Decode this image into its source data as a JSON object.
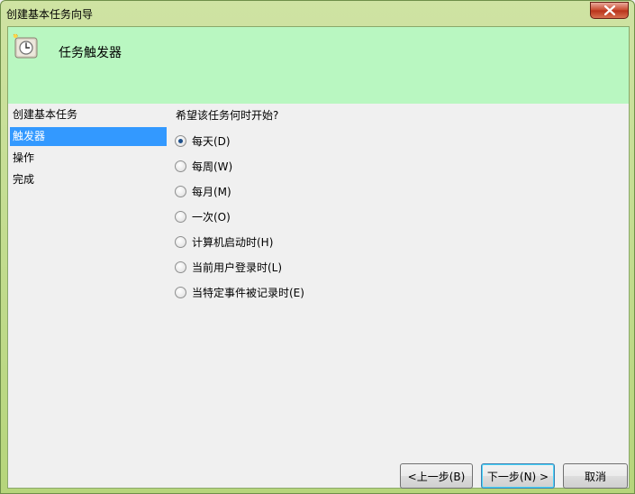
{
  "window": {
    "title": "创建基本任务向导"
  },
  "header": {
    "title": "任务触发器",
    "icon": "clock-icon"
  },
  "steps": [
    {
      "label": "创建基本任务",
      "active": false
    },
    {
      "label": "触发器",
      "active": true
    },
    {
      "label": "操作",
      "active": false
    },
    {
      "label": "完成",
      "active": false
    }
  ],
  "content": {
    "question": "希望该任务何时开始?",
    "options": [
      {
        "label": "每天(D)",
        "checked": true
      },
      {
        "label": "每周(W)",
        "checked": false
      },
      {
        "label": "每月(M)",
        "checked": false
      },
      {
        "label": "一次(O)",
        "checked": false
      },
      {
        "label": "计算机启动时(H)",
        "checked": false
      },
      {
        "label": "当前用户登录时(L)",
        "checked": false
      },
      {
        "label": "当特定事件被记录时(E)",
        "checked": false
      }
    ]
  },
  "buttons": {
    "back": "<上一步(B)",
    "next": "下一步(N) >",
    "cancel": "取消"
  },
  "colors": {
    "header_bg": "#b9f7c1",
    "selection": "#3399ff"
  }
}
